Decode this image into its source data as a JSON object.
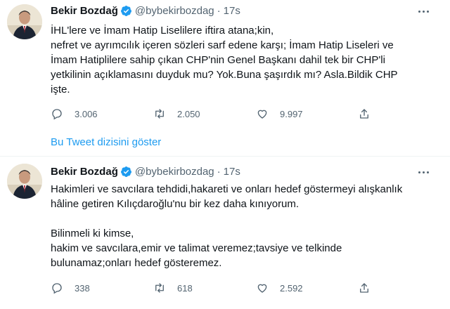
{
  "tweets": [
    {
      "author_name": "Bekir Bozdağ",
      "handle": "@bybekirbozdag",
      "separator": "·",
      "time": "17s",
      "lines": [
        "İHL'lere ve İmam Hatip Liselilere iftira atana;kin,",
        "nefret ve ayrımcılık içeren sözleri sarf edene karşı; İmam Hatip Liseleri ve",
        "İmam Hatiplilere sahip çıkan CHP'nin Genel Başkanı dahil tek bir CHP'li",
        "yetkilinin açıklamasını duyduk mu? Yok.Buna şaşırdık mı? Asla.Bildik CHP",
        "işte."
      ],
      "replies": "3.006",
      "retweets": "2.050",
      "likes": "9.997"
    },
    {
      "author_name": "Bekir Bozdağ",
      "handle": "@bybekirbozdag",
      "separator": "·",
      "time": "17s",
      "lines": [
        "Hakimleri ve savcılara tehdidi,hakareti ve onları hedef göstermeyi alışkanlık",
        "hâline getiren Kılıçdaroğlu'nu bir kez daha kınıyorum.",
        "",
        "Bilinmeli ki kimse,",
        "hakim ve savcılara,emir ve talimat veremez;tavsiye ve telkinde",
        "bulunamaz;onları hedef gösteremez."
      ],
      "replies": "338",
      "retweets": "618",
      "likes": "2.592"
    }
  ],
  "thread_link": "Bu Tweet dizisini göster",
  "icons": {
    "reply": "reply-icon",
    "retweet": "retweet-icon",
    "like": "heart-icon",
    "share": "share-icon",
    "verified": "verified-badge-icon",
    "more": "more-options-icon"
  },
  "colors": {
    "accent": "#1d9bf0",
    "secondary_text": "#536471",
    "primary_text": "#0f1419"
  }
}
